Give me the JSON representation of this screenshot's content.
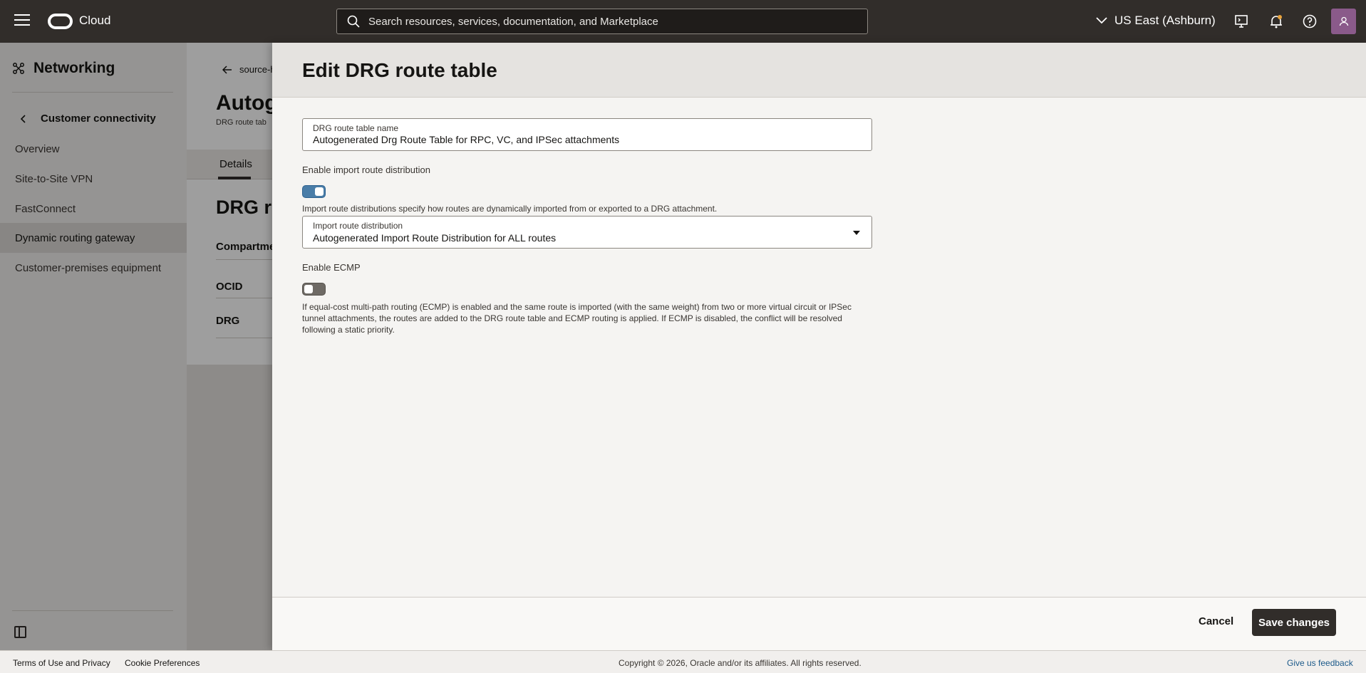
{
  "topbar": {
    "brand": "Cloud",
    "search_placeholder": "Search resources, services, documentation, and Marketplace",
    "region": "US East (Ashburn)",
    "icons": [
      "menu-icon",
      "oracle-logo-icon",
      "search-icon",
      "chevron-down-icon",
      "cloud-shell-icon",
      "bell-icon",
      "help-icon",
      "user-icon"
    ]
  },
  "sidebar": {
    "title": "Networking",
    "back_label": "Customer connectivity",
    "items": [
      {
        "label": "Overview"
      },
      {
        "label": "Site-to-Site VPN"
      },
      {
        "label": "FastConnect"
      },
      {
        "label": "Dynamic routing gateway",
        "active": true
      },
      {
        "label": "Customer-premises equipment"
      }
    ]
  },
  "background": {
    "breadcrumb": "source-h",
    "title": "Autog",
    "subtitle": "DRG route tab",
    "tab": "Details",
    "section_title": "DRG r",
    "detail_labels": [
      "Compartme",
      "OCID",
      "DRG"
    ]
  },
  "panel": {
    "title": "Edit DRG route table",
    "name_field": {
      "label": "DRG route table name",
      "value": "Autogenerated Drg Route Table for RPC, VC, and IPSec attachments"
    },
    "import_toggle": {
      "label": "Enable import route distribution",
      "on": true,
      "help": "Import route distributions specify how routes are dynamically imported from or exported to a DRG attachment."
    },
    "import_select": {
      "label": "Import route distribution",
      "value": "Autogenerated Import Route Distribution for ALL routes"
    },
    "ecmp_toggle": {
      "label": "Enable ECMP",
      "on": false,
      "help_lines": [
        "If equal-cost multi-path routing (ECMP) is enabled and the same route is imported (with the same weight) from two or more virtual circuit or IPSec",
        "tunnel attachments, the routes are added to the DRG route table and ECMP routing is applied. If ECMP is disabled, the conflict will be resolved",
        "following a static priority."
      ]
    },
    "cancel_label": "Cancel",
    "save_label": "Save changes"
  },
  "footer": {
    "terms": "Terms of Use and Privacy",
    "cookies": "Cookie Preferences",
    "copyright": "Copyright © 2026, Oracle and/or its affiliates. All rights reserved.",
    "feedback": "Give us feedback"
  },
  "colors": {
    "topbar": "#312d2a",
    "toggle_on": "#4a7da8",
    "primary_button": "#312d2a",
    "feedback_link": "#1c5a8a"
  }
}
